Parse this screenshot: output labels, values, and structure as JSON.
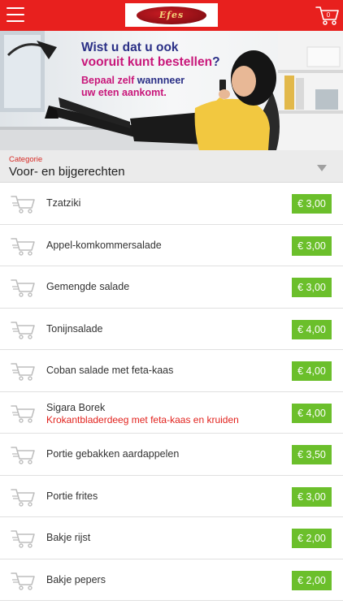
{
  "header": {
    "logo_text": "Efes",
    "cart_count": "0"
  },
  "banner": {
    "line1": "Wist u dat u ook",
    "line2_part1": "vooruit kunt ",
    "line2_part2": "bestellen",
    "line2_part3": "?",
    "sub_part1": "Bepaal zelf ",
    "sub_part2": "wannneer",
    "sub_line2": "uw eten aankomt."
  },
  "category": {
    "label": "Categorie",
    "value": "Voor- en bijgerechten"
  },
  "items": [
    {
      "name": "Tzatziki",
      "description": "",
      "price": "€ 3,00"
    },
    {
      "name": "Appel-komkommersalade",
      "description": "",
      "price": "€ 3,00"
    },
    {
      "name": "Gemengde salade",
      "description": "",
      "price": "€ 3,00"
    },
    {
      "name": "Tonijnsalade",
      "description": "",
      "price": "€ 4,00"
    },
    {
      "name": "Coban salade met feta-kaas",
      "description": "",
      "price": "€ 4,00"
    },
    {
      "name": "Sigara Borek",
      "description": "Krokantbladerdeeg met feta-kaas en kruiden",
      "price": "€ 4,00"
    },
    {
      "name": "Portie gebakken aardappelen",
      "description": "",
      "price": "€ 3,50"
    },
    {
      "name": "Portie frites",
      "description": "",
      "price": "€ 3,00"
    },
    {
      "name": "Bakje rijst",
      "description": "",
      "price": "€ 2,00"
    },
    {
      "name": "Bakje pepers",
      "description": "",
      "price": "€ 2,00"
    }
  ],
  "colors": {
    "header": "#e8201e",
    "price_badge": "#6bbf2b",
    "category_label": "#d62a24",
    "description": "#e2231e"
  },
  "icons": {
    "menu": "hamburger-menu-icon",
    "cart": "shopping-cart-icon",
    "row_cart": "add-to-cart-icon",
    "dropdown": "dropdown-arrow-icon"
  }
}
